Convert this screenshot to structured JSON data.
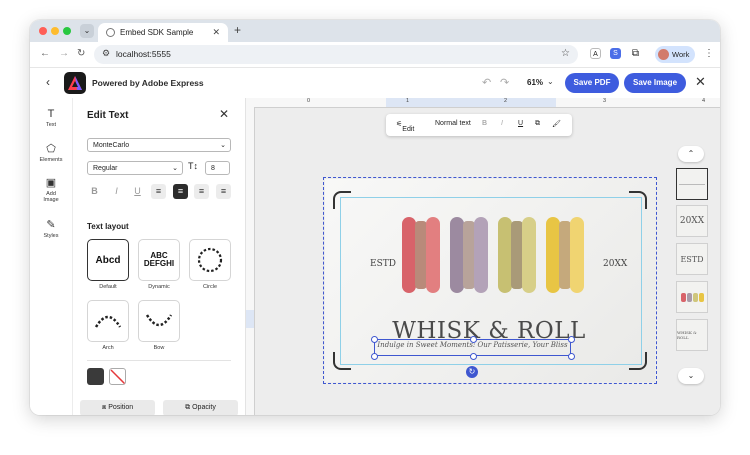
{
  "browser": {
    "tab_title": "Embed SDK Sample",
    "url": "localhost:5555",
    "profile_label": "Work",
    "ext_a": "A",
    "ext_s": "S"
  },
  "app": {
    "powered_by": "Powered by Adobe Express",
    "zoom": "61%",
    "save_pdf": "Save PDF",
    "save_image": "Save Image"
  },
  "rail": [
    {
      "label": "Text",
      "icon": "text-icon"
    },
    {
      "label": "Elements",
      "icon": "shapes-icon"
    },
    {
      "label": "Add Image",
      "icon": "image-icon"
    },
    {
      "label": "Styles",
      "icon": "styles-icon"
    }
  ],
  "panel": {
    "title": "Edit Text",
    "font": "MonteCarlo",
    "weight": "Regular",
    "size": "8",
    "section_layout": "Text layout",
    "layouts": [
      {
        "caption": "Default",
        "sample": "Abcd"
      },
      {
        "caption": "Dynamic",
        "sample": "ABC DEFGHI"
      },
      {
        "caption": "Circle",
        "sample": "ABCDEFGHIJKL"
      },
      {
        "caption": "Arch",
        "sample": "ABCDEFG"
      },
      {
        "caption": "Bow",
        "sample": "ABCDEFG"
      }
    ],
    "position_label": "Position",
    "opacity_label": "Opacity",
    "colors": {
      "text_swatch": "#3a3a3a",
      "accent": "#3e5cde"
    }
  },
  "canvas": {
    "ruler_ticks": [
      "0",
      "1",
      "2",
      "3",
      "4"
    ],
    "toolbar": {
      "edit_label": "Edit",
      "style_label": "Normal text",
      "b": "B",
      "i": "I",
      "u": "U"
    },
    "design": {
      "left_text": "ESTD",
      "right_text": "20XX",
      "headline": "WHISK & ROLL",
      "tagline": "Indulge in Sweet Moments: Our Patisserie, Your Bliss"
    },
    "pages": [
      "20XX",
      "ESTD",
      "WHISK & ROLL"
    ]
  }
}
